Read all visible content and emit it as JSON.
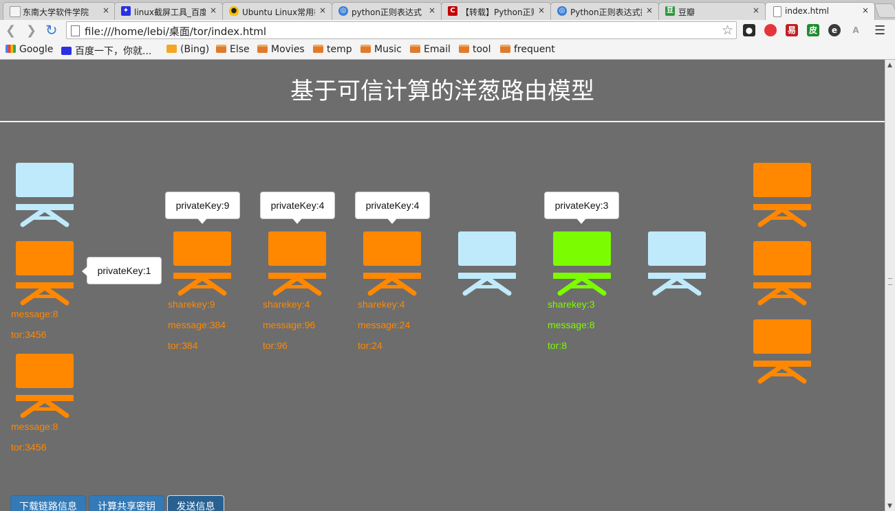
{
  "browser": {
    "tabs": [
      {
        "label": "东南大学软件学院",
        "icon": "seu-icon",
        "color": "#f4f4f4",
        "close": "×"
      },
      {
        "label": "linux截屏工具_百度",
        "icon": "baidu-paw-icon",
        "color": "#2932e1",
        "close": "×"
      },
      {
        "label": "Ubuntu Linux常用截",
        "icon": "tux-penguin-icon",
        "color": "#222222",
        "close": "×"
      },
      {
        "label": "python正则表达式 -",
        "icon": "globe-icon",
        "color": "#3a7fd6",
        "close": "×"
      },
      {
        "label": "【转载】Python正则",
        "icon": "cnblogs-icon",
        "color": "#c40000",
        "close": "×"
      },
      {
        "label": "Python正则表达式拼",
        "icon": "globe-icon",
        "color": "#3a7fd6",
        "close": "×"
      },
      {
        "label": "豆瓣",
        "icon": "douban-icon",
        "color": "#2e963d",
        "close": "×"
      },
      {
        "label": "index.html",
        "icon": "page-icon",
        "color": "#ffffff",
        "close": "×"
      }
    ],
    "url": "file:///home/lebi/桌面/tor/index.html",
    "bookmarks": [
      {
        "label": "Google",
        "icon": "google-icon"
      },
      {
        "label": "百度一下，你就...",
        "icon": "baidu-paw-icon"
      },
      {
        "label": "(Bing)",
        "icon": "bing-icon"
      },
      {
        "label": "Else",
        "icon": "folder-icon"
      },
      {
        "label": "Movies",
        "icon": "folder-icon"
      },
      {
        "label": "temp",
        "icon": "folder-icon"
      },
      {
        "label": "Music",
        "icon": "folder-icon"
      },
      {
        "label": "Email",
        "icon": "folder-icon"
      },
      {
        "label": "tool",
        "icon": "folder-icon"
      },
      {
        "label": "frequent",
        "icon": "folder-icon"
      }
    ],
    "extensions": [
      {
        "name": "wechat-extension-icon",
        "label": "",
        "color": "#2b2b2b"
      },
      {
        "name": "weibo-extension-icon",
        "label": "",
        "color": "#e5343a"
      },
      {
        "name": "youdao-extension-icon",
        "label": "易",
        "color": "#c41e23"
      },
      {
        "name": "pi-extension-icon",
        "label": "皮",
        "color": "#1f8c2f"
      },
      {
        "name": "evernote-extension-icon",
        "label": "",
        "color": "#3a3a3a"
      },
      {
        "name": "translate-extension-icon",
        "label": "A",
        "color": "#9aa0a6"
      }
    ]
  },
  "page": {
    "title": "基于可信计算的洋葱路由模型",
    "colors": {
      "background": "#6d6d6d",
      "orange": "#ff8800",
      "light_blue": "#bfeafb",
      "green": "#7cfc00"
    },
    "nodes": [
      {
        "id": "left-1",
        "color": "light_blue",
        "info": []
      },
      {
        "id": "left-2",
        "color": "orange",
        "info": [
          "message:8",
          "tor:3456"
        ],
        "tip": "privateKey:1"
      },
      {
        "id": "left-3",
        "color": "orange",
        "info": [
          "message:8",
          "tor:3456"
        ]
      },
      {
        "id": "relay-1",
        "color": "orange",
        "info": [
          "sharekey:9",
          "message:384",
          "tor:384"
        ],
        "tip": "privateKey:9"
      },
      {
        "id": "relay-2",
        "color": "orange",
        "info": [
          "sharekey:4",
          "message:96",
          "tor:96"
        ],
        "tip": "privateKey:4"
      },
      {
        "id": "relay-3",
        "color": "orange",
        "info": [
          "sharekey:4",
          "message:24",
          "tor:24"
        ],
        "tip": "privateKey:4"
      },
      {
        "id": "relay-4",
        "color": "light_blue",
        "info": []
      },
      {
        "id": "relay-5",
        "color": "green",
        "info": [
          "sharekey:3",
          "message:8",
          "tor:8"
        ],
        "tip": "privateKey:3"
      },
      {
        "id": "relay-6",
        "color": "light_blue",
        "info": []
      },
      {
        "id": "right-1",
        "color": "orange",
        "info": []
      },
      {
        "id": "right-2",
        "color": "orange",
        "info": []
      },
      {
        "id": "right-3",
        "color": "orange",
        "info": []
      }
    ],
    "buttons": [
      {
        "label": "下载链路信息"
      },
      {
        "label": "计算共享密钥"
      },
      {
        "label": "发送信息"
      }
    ]
  }
}
